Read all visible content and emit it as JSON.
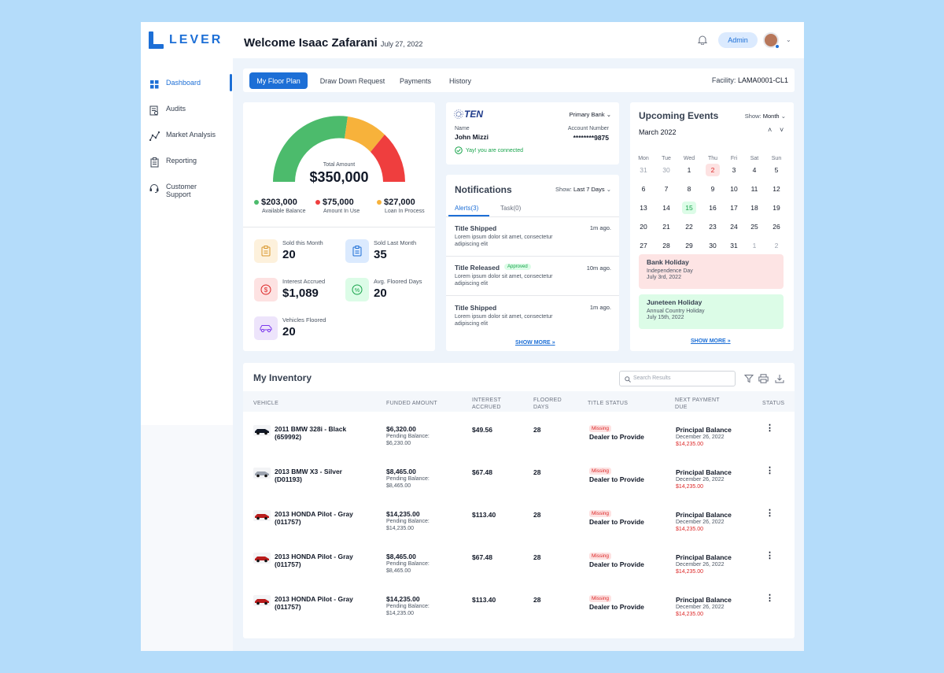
{
  "brand": {
    "name": "LEVER",
    "color": "#1d6fd6"
  },
  "sidebar": {
    "items": [
      {
        "label": "Dashboard",
        "icon": "dashboard-icon",
        "active": true
      },
      {
        "label": "Audits",
        "icon": "audits-icon"
      },
      {
        "label": "Market Analysis",
        "icon": "chart-icon"
      },
      {
        "label": "Reporting",
        "icon": "clipboard-icon"
      },
      {
        "label": "Customer Support",
        "icon": "headset-icon"
      }
    ]
  },
  "header": {
    "welcome": "Welcome Isaac Zafarani",
    "date": "July 27, 2022",
    "admin_label": "Admin"
  },
  "tabs": [
    "My Floor Plan",
    "Draw Down Request",
    "Payments",
    "History"
  ],
  "facility": {
    "label": "Facility:",
    "value": "LAMA0001-CL1"
  },
  "gauge": {
    "total_label": "Total Amount",
    "total_value": "$350,000",
    "segments": [
      {
        "name": "Available Balance",
        "value": "$203,000",
        "color": "#4cbb6c"
      },
      {
        "name": "Amount In Use",
        "value": "$75,000",
        "color": "#ef3e3e"
      },
      {
        "name": "Loan In Process",
        "value": "$27,000",
        "color": "#f7b23b"
      }
    ]
  },
  "stats": [
    {
      "label": "Sold this Month",
      "value": "20",
      "icon": "clipboard-icon",
      "bg": "#fdf1dc"
    },
    {
      "label": "Sold Last Month",
      "value": "35",
      "icon": "clipboard-icon",
      "bg": "#dbeafe"
    },
    {
      "label": "Interest Accrued",
      "value": "$1,089",
      "icon": "dollar-icon",
      "bg": "#fde2e2"
    },
    {
      "label": "Avg. Floored Days",
      "value": "20",
      "icon": "percent-icon",
      "bg": "#dcfce7"
    },
    {
      "label": "Vehicles Floored",
      "value": "20",
      "icon": "car-icon",
      "bg": "#ede4fb"
    }
  ],
  "bank": {
    "logo_text": "TEN",
    "select_label": "Primary Bank",
    "name_label": "Name",
    "name": "John Mizzi",
    "account_label": "Account Number",
    "account": "********9875",
    "connected": "Yay! you are connected"
  },
  "notifications": {
    "title": "Notifications",
    "show_label": "Show:",
    "show_value": "Last 7 Days",
    "tabs": [
      "Alerts(3)",
      "Task(0)"
    ],
    "items": [
      {
        "title": "Title Shipped",
        "badge": "",
        "time": "1m ago.",
        "body": "Lorem ipsum dolor sit amet, consectetur adipiscing elit"
      },
      {
        "title": "Title Released",
        "badge": "Approved",
        "time": "10m ago.",
        "body": "Lorem ipsum dolor sit amet, consectetur adipiscing elit"
      },
      {
        "title": "Title Shipped",
        "badge": "",
        "time": "1m ago.",
        "body": "Lorem ipsum dolor sit amet, consectetur adipiscing elit"
      }
    ],
    "show_more": "SHOW MORE"
  },
  "events": {
    "title": "Upcoming Events",
    "show_label": "Show:",
    "show_value": "Month",
    "month": "March 2022",
    "weekdays": [
      "Mon",
      "Tue",
      "Wed",
      "Thu",
      "Fri",
      "Sat",
      "Sun"
    ],
    "weeks": [
      [
        "31",
        "30",
        "1",
        "2",
        "3",
        "4",
        "5"
      ],
      [
        "6",
        "7",
        "8",
        "9",
        "10",
        "11",
        "12"
      ],
      [
        "13",
        "14",
        "15",
        "16",
        "17",
        "18",
        "19"
      ],
      [
        "20",
        "21",
        "22",
        "23",
        "24",
        "25",
        "26"
      ],
      [
        "27",
        "28",
        "29",
        "30",
        "31",
        "1",
        "2"
      ]
    ],
    "list": [
      {
        "title": "Bank Holiday",
        "subtitle": "Independence Day",
        "date": "July 3rd, 2022",
        "bg": "#fde4e4"
      },
      {
        "title": "Juneteen Holiday",
        "subtitle": "Annual Country Holiday",
        "date": "July 15th, 2022",
        "bg": "#dcfce7"
      }
    ],
    "show_more": "SHOW MORE"
  },
  "inventory": {
    "title": "My Inventory",
    "search_placeholder": "Search Results",
    "columns": [
      "VEHICLE",
      "FUNDED AMOUNT",
      "INTEREST ACCRUED",
      "FLOORED DAYS",
      "TITLE STATUS",
      "NEXT PAYMENT DUE",
      "STATUS"
    ],
    "rows": [
      {
        "vehicle": "2011 BMW 328i - Black (659992)",
        "funded": "$6,320.00",
        "pending_label": "Pending Balance:",
        "pending": "$6,230.00",
        "interest": "$49.56",
        "days": "28",
        "title_badge": "Missing",
        "title_status": "Dealer to Provide",
        "payment_title": "Principal Balance",
        "payment_date": "December 26, 2022",
        "payment_amount": "$14,235.00",
        "car_color": "#111827"
      },
      {
        "vehicle": "2013 BMW X3 - Silver (D01193)",
        "funded": "$8,465.00",
        "pending_label": "Pending Balance:",
        "pending": "$8,465.00",
        "interest": "$67.48",
        "days": "28",
        "title_badge": "Missing",
        "title_status": "Dealer to Provide",
        "payment_title": "Principal Balance",
        "payment_date": "December 26, 2022",
        "payment_amount": "$14,235.00",
        "car_color": "#9ca3af"
      },
      {
        "vehicle": "2013 HONDA Pilot - Gray (011757)",
        "funded": "$14,235.00",
        "pending_label": "Pending Balance:",
        "pending": "$14,235.00",
        "interest": "$113.40",
        "days": "28",
        "title_badge": "Missing",
        "title_status": "Dealer to Provide",
        "payment_title": "Principal Balance",
        "payment_date": "December 26, 2022",
        "payment_amount": "$14,235.00",
        "car_color": "#b91c1c"
      },
      {
        "vehicle": "2013 HONDA Pilot - Gray (011757)",
        "funded": "$8,465.00",
        "pending_label": "Pending Balance:",
        "pending": "$8,465.00",
        "interest": "$67.48",
        "days": "28",
        "title_badge": "Missing",
        "title_status": "Dealer to Provide",
        "payment_title": "Principal Balance",
        "payment_date": "December 26, 2022",
        "payment_amount": "$14,235.00",
        "car_color": "#b91c1c"
      },
      {
        "vehicle": "2013 HONDA Pilot - Gray (011757)",
        "funded": "$14,235.00",
        "pending_label": "Pending Balance:",
        "pending": "$14,235.00",
        "interest": "$113.40",
        "days": "28",
        "title_badge": "Missing",
        "title_status": "Dealer to Provide",
        "payment_title": "Principal Balance",
        "payment_date": "December 26, 2022",
        "payment_amount": "$14,235.00",
        "car_color": "#b91c1c"
      }
    ]
  }
}
